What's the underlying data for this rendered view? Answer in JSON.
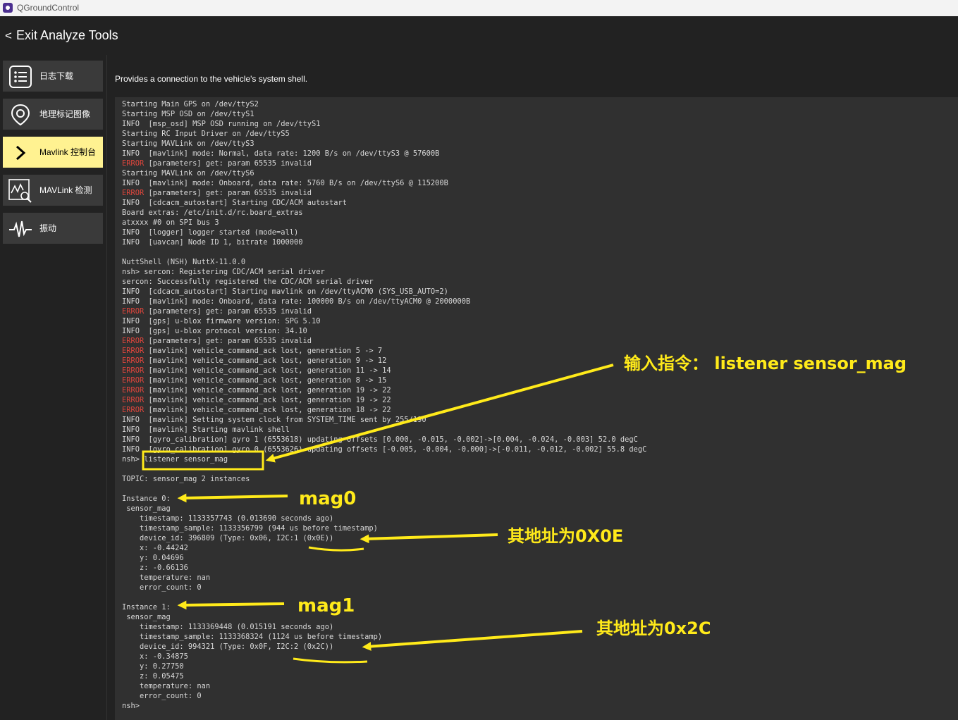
{
  "window": {
    "title": "QGroundControl"
  },
  "header": {
    "back_chevron": "<",
    "back_label": "Exit Analyze Tools"
  },
  "sidebar": {
    "items": [
      {
        "label": "日志下载",
        "icon": "list-icon"
      },
      {
        "label": "地理标记图像",
        "icon": "map-pin-icon"
      },
      {
        "label": "Mavlink 控制台",
        "icon": "chevron-right-icon",
        "active": true
      },
      {
        "label": "MAVLink 检测",
        "icon": "chart-search-icon"
      },
      {
        "label": "振动",
        "icon": "waveform-icon"
      }
    ]
  },
  "page": {
    "description": "Provides a connection to the vehicle's system shell."
  },
  "console": {
    "lines": [
      [
        "",
        "Starting Main GPS on /dev/ttyS2"
      ],
      [
        "",
        "Starting MSP OSD on /dev/ttyS1"
      ],
      [
        "INFO  ",
        "[msp_osd] MSP OSD running on /dev/ttyS1"
      ],
      [
        "",
        "Starting RC Input Driver on /dev/ttyS5"
      ],
      [
        "",
        "Starting MAVLink on /dev/ttyS3"
      ],
      [
        "INFO  ",
        "[mavlink] mode: Normal, data rate: 1200 B/s on /dev/ttyS3 @ 57600B"
      ],
      [
        "ERROR ",
        "[parameters] get: param 65535 invalid"
      ],
      [
        "",
        "Starting MAVLink on /dev/ttyS6"
      ],
      [
        "INFO  ",
        "[mavlink] mode: Onboard, data rate: 5760 B/s on /dev/ttyS6 @ 115200B"
      ],
      [
        "ERROR ",
        "[parameters] get: param 65535 invalid"
      ],
      [
        "INFO  ",
        "[cdcacm_autostart] Starting CDC/ACM autostart"
      ],
      [
        "",
        "Board extras: /etc/init.d/rc.board_extras"
      ],
      [
        "",
        "atxxxx #0 on SPI bus 3"
      ],
      [
        "INFO  ",
        "[logger] logger started (mode=all)"
      ],
      [
        "INFO  ",
        "[uavcan] Node ID 1, bitrate 1000000"
      ],
      [
        "",
        ""
      ],
      [
        "",
        "NuttShell (NSH) NuttX-11.0.0"
      ],
      [
        "",
        "nsh> sercon: Registering CDC/ACM serial driver"
      ],
      [
        "",
        "sercon: Successfully registered the CDC/ACM serial driver"
      ],
      [
        "INFO  ",
        "[cdcacm_autostart] Starting mavlink on /dev/ttyACM0 (SYS_USB_AUTO=2)"
      ],
      [
        "INFO  ",
        "[mavlink] mode: Onboard, data rate: 100000 B/s on /dev/ttyACM0 @ 2000000B"
      ],
      [
        "ERROR ",
        "[parameters] get: param 65535 invalid"
      ],
      [
        "INFO  ",
        "[gps] u-blox firmware version: SPG 5.10"
      ],
      [
        "INFO  ",
        "[gps] u-blox protocol version: 34.10"
      ],
      [
        "ERROR ",
        "[parameters] get: param 65535 invalid"
      ],
      [
        "ERROR ",
        "[mavlink] vehicle_command_ack lost, generation 5 -> 7"
      ],
      [
        "ERROR ",
        "[mavlink] vehicle_command_ack lost, generation 9 -> 12"
      ],
      [
        "ERROR ",
        "[mavlink] vehicle_command_ack lost, generation 11 -> 14"
      ],
      [
        "ERROR ",
        "[mavlink] vehicle_command_ack lost, generation 8 -> 15"
      ],
      [
        "ERROR ",
        "[mavlink] vehicle_command_ack lost, generation 19 -> 22"
      ],
      [
        "ERROR ",
        "[mavlink] vehicle_command_ack lost, generation 19 -> 22"
      ],
      [
        "ERROR ",
        "[mavlink] vehicle_command_ack lost, generation 18 -> 22"
      ],
      [
        "INFO  ",
        "[mavlink] Setting system clock from SYSTEM_TIME sent by 255/190"
      ],
      [
        "INFO  ",
        "[mavlink] Starting mavlink shell"
      ],
      [
        "INFO  ",
        "[gyro_calibration] gyro 1 (6553618) updating offsets [0.000, -0.015, -0.002]->[0.004, -0.024, -0.003] 52.0 degC"
      ],
      [
        "INFO  ",
        "[gyro_calibration] gyro 0 (6553626) updating offsets [-0.005, -0.004, -0.000]->[-0.011, -0.012, -0.002] 55.8 degC"
      ],
      [
        "",
        "nsh> listener sensor_mag"
      ],
      [
        "",
        ""
      ],
      [
        "",
        "TOPIC: sensor_mag 2 instances"
      ],
      [
        "",
        ""
      ],
      [
        "",
        "Instance 0:"
      ],
      [
        "",
        " sensor_mag"
      ],
      [
        "",
        "    timestamp: 1133357743 (0.013690 seconds ago)"
      ],
      [
        "",
        "    timestamp_sample: 1133356799 (944 us before timestamp)"
      ],
      [
        "",
        "    device_id: 396809 (Type: 0x06, I2C:1 (0x0E))"
      ],
      [
        "",
        "    x: -0.44242"
      ],
      [
        "",
        "    y: 0.04696"
      ],
      [
        "",
        "    z: -0.66136"
      ],
      [
        "",
        "    temperature: nan"
      ],
      [
        "",
        "    error_count: 0"
      ],
      [
        "",
        ""
      ],
      [
        "",
        "Instance 1:"
      ],
      [
        "",
        " sensor_mag"
      ],
      [
        "",
        "    timestamp: 1133369448 (0.015191 seconds ago)"
      ],
      [
        "",
        "    timestamp_sample: 1133368324 (1124 us before timestamp)"
      ],
      [
        "",
        "    device_id: 994321 (Type: 0x0F, I2C:2 (0x2C))"
      ],
      [
        "",
        "    x: -0.34875"
      ],
      [
        "",
        "    y: 0.27750"
      ],
      [
        "",
        "    z: 0.05475"
      ],
      [
        "",
        "    temperature: nan"
      ],
      [
        "",
        "    error_count: 0"
      ],
      [
        "",
        "nsh>"
      ]
    ]
  },
  "annotations": {
    "command": "输入指令： listener sensor_mag",
    "mag0": "mag0",
    "mag0_address": "其地址为0X0E",
    "mag1": "mag1",
    "mag1_address": "其地址为0x2C"
  },
  "colors": {
    "background": "#222222",
    "console_bg": "#303030",
    "console_text": "#d8d8d8",
    "error": "#e0463c",
    "active_item": "#fff291",
    "annotation": "#ffea1a"
  }
}
